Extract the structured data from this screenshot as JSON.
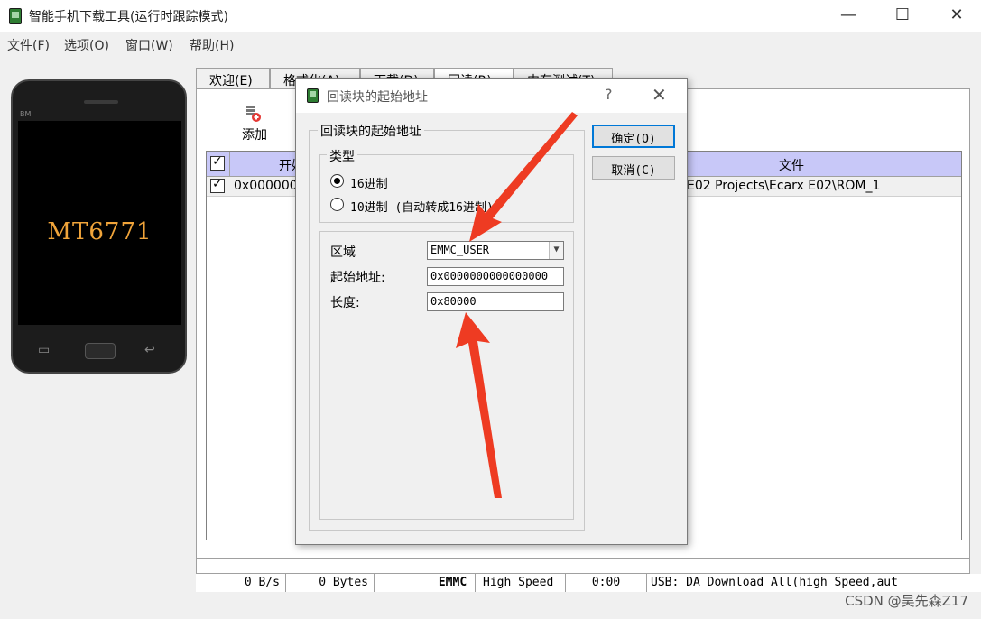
{
  "window": {
    "title": "智能手机下载工具(运行时跟踪模式)",
    "minimize": "—",
    "maximize": "☐",
    "close": "✕"
  },
  "menu": [
    "文件(F)",
    "选项(O)",
    "窗口(W)",
    "帮助(H)"
  ],
  "phone": {
    "brand": "BM",
    "chip": "MT6771"
  },
  "tabs": [
    "欢迎(E)",
    "格式化(A)",
    "下载(D)",
    "回读(R)",
    "内存测试(T)"
  ],
  "toolbar": {
    "add_label": "添加"
  },
  "table": {
    "col_start": "开始",
    "col_file": "文件",
    "rows": [
      {
        "start": "0x000000",
        "file": "E02 Projects\\Ecarx E02\\ROM_1"
      }
    ]
  },
  "status": {
    "speed": "0 B/s",
    "bytes": "0 Bytes",
    "storage": "EMMC",
    "mode": "High Speed",
    "time": "0:00",
    "usb": "USB: DA Download All(high Speed,aut"
  },
  "watermark": "CSDN @吴先森Z17",
  "dialog": {
    "title": "回读块的起始地址",
    "help": "?",
    "close": "✕",
    "group_label": "回读块的起始地址",
    "type_label": "类型",
    "radio_hex": "16进制",
    "radio_dec": "10进制 (自动转成16进制)",
    "region_label": "区域",
    "region_value": "EMMC_USER",
    "start_label": "起始地址:",
    "start_value": "0x0000000000000000",
    "length_label": "长度:",
    "length_value": "0x80000",
    "ok_button": "确定(O)",
    "cancel_button": "取消(C)"
  },
  "annotation_color": "#ee3b22"
}
